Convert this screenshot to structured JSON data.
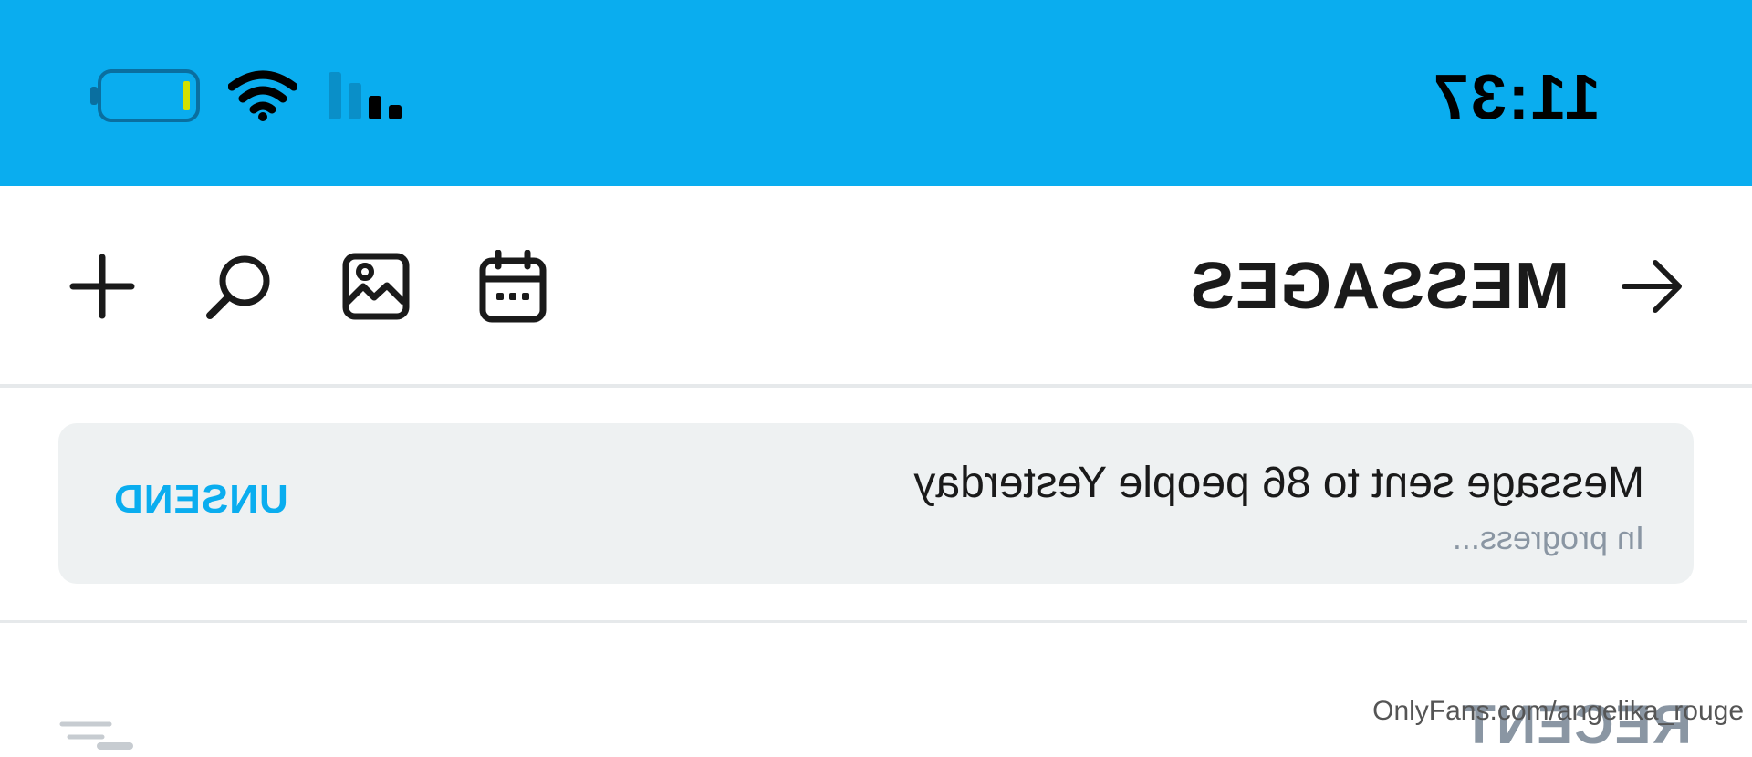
{
  "status_bar": {
    "time": "11:37",
    "icons": [
      "signal-icon",
      "wifi-icon",
      "battery-icon"
    ],
    "battery_accent": "#d4e000"
  },
  "header": {
    "title": "MESSAGES",
    "back_icon": "arrow-left-icon",
    "toolbar_icons": [
      "calendar-icon",
      "image-icon",
      "search-icon",
      "plus-icon"
    ]
  },
  "notice": {
    "title": "Message sent to 86 people Yesterday",
    "status": "In progress...",
    "action_label": "UNSEND"
  },
  "section": {
    "title": "RECENT",
    "sort_icon": "sort-icon"
  },
  "watermark": "OnlyFans.com/angelika_rouge",
  "colors": {
    "accent": "#0aadef",
    "muted": "#8a96a3",
    "card_bg": "#eef1f2"
  }
}
